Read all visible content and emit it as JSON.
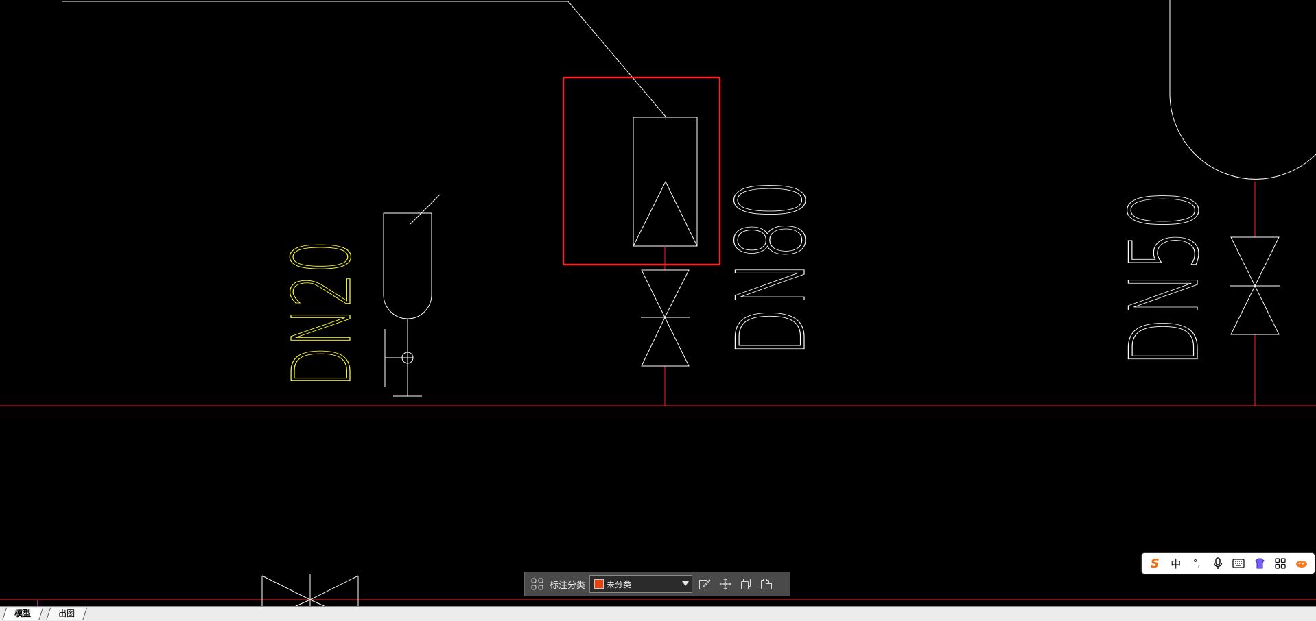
{
  "drawing": {
    "labels": {
      "dn20": "DN20",
      "dn80": "DN80",
      "dn50": "DN50"
    },
    "colors": {
      "background": "#000000",
      "line_white": "#ffffff",
      "line_red": "#ff2020",
      "text_yellow": "#ffff33",
      "selection_red": "#ff2020"
    }
  },
  "annotation_toolbar": {
    "label": "标注分类",
    "category_value": "未分类",
    "category_color": "#e8420c",
    "icons": [
      "grid-icon",
      "edit-icon",
      "move-icon",
      "copy-icon",
      "paste-icon"
    ]
  },
  "tabs": [
    {
      "label": "模型",
      "active": true
    },
    {
      "label": "出图",
      "active": false
    }
  ],
  "ime": {
    "logo": "S",
    "mode": "中",
    "punct": "°,",
    "icons": [
      "sogou-logo-icon",
      "chinese-mode-icon",
      "punctuation-icon",
      "microphone-icon",
      "keyboard-icon",
      "skin-icon",
      "apps-icon",
      "mascot-icon"
    ]
  }
}
